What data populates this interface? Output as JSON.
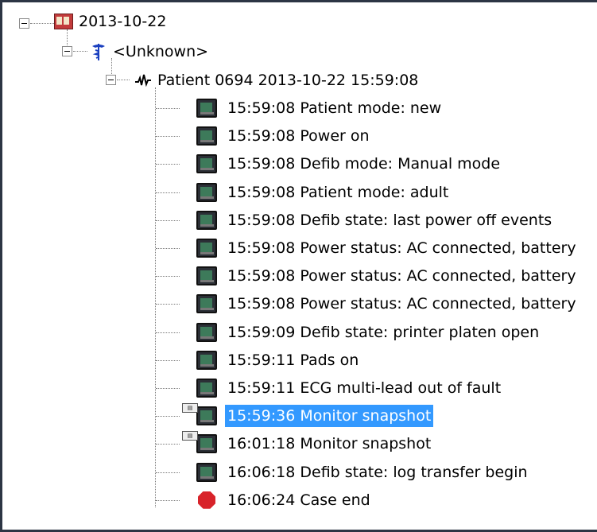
{
  "tree": {
    "root": {
      "label": "2013-10-22",
      "icon": "calendar-icon"
    },
    "provider": {
      "label": "<Unknown>",
      "icon": "caduceus-icon"
    },
    "patient": {
      "label": "Patient 0694 2013-10-22 15:59:08",
      "icon": "ecg-waveform-icon"
    },
    "events": [
      {
        "label": "15:59:08 Patient mode: new",
        "icon": "monitor-device-icon"
      },
      {
        "label": "15:59:08 Power on",
        "icon": "monitor-device-icon"
      },
      {
        "label": "15:59:08 Defib mode: Manual mode",
        "icon": "monitor-device-icon"
      },
      {
        "label": "15:59:08 Patient mode: adult",
        "icon": "monitor-device-icon"
      },
      {
        "label": "15:59:08 Defib state: last power off events",
        "icon": "monitor-device-icon"
      },
      {
        "label": "15:59:08 Power status: AC connected, battery",
        "icon": "monitor-device-icon"
      },
      {
        "label": "15:59:08 Power status: AC connected, battery",
        "icon": "monitor-device-icon"
      },
      {
        "label": "15:59:08 Power status: AC connected, battery",
        "icon": "monitor-device-icon"
      },
      {
        "label": "15:59:09 Defib state: printer platen open",
        "icon": "monitor-device-icon"
      },
      {
        "label": "15:59:11 Pads on",
        "icon": "monitor-device-icon"
      },
      {
        "label": "15:59:11 ECG multi-lead out of fault",
        "icon": "monitor-device-icon"
      },
      {
        "label": "15:59:36 Monitor snapshot",
        "icon": "snapshot-monitor-icon",
        "selected": true
      },
      {
        "label": "16:01:18 Monitor snapshot",
        "icon": "snapshot-monitor-icon"
      },
      {
        "label": "16:06:18 Defib state: log transfer begin",
        "icon": "monitor-device-icon"
      },
      {
        "label": "16:06:24 Case end",
        "icon": "stop-icon"
      }
    ]
  },
  "colors": {
    "selection": "#3399ff",
    "border": "#2c3544",
    "stop": "#d8232a"
  }
}
